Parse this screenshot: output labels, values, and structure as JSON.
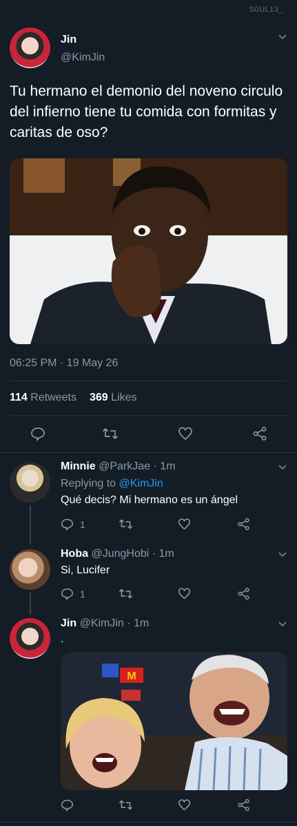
{
  "watermark": "S0UL13_",
  "main_tweet": {
    "name": "Jin",
    "handle": "@KimJin",
    "text": "Tu hermano el demonio del noveno circulo del infierno tiene tu comida con formitas y caritas de oso?",
    "timestamp": "06:25 PM · 19 May 26",
    "retweets_count": "114",
    "retweets_label": "Retweets",
    "likes_count": "369",
    "likes_label": "Likes"
  },
  "replies": [
    {
      "name": "Minnie",
      "handle": "@ParkJae",
      "time": "· 1m",
      "replying_prefix": "Replying to",
      "replying_to": "@KimJin",
      "text": "Qué decis? Mi hermano es un ángel",
      "reply_count": "1"
    },
    {
      "name": "Hoba",
      "handle": "@JungHobi",
      "time": "· 1m",
      "text": "Si, Lucifer",
      "reply_count": "1"
    },
    {
      "name": "Jin",
      "handle": "@KimJin",
      "time": "· 1m",
      "text": "."
    }
  ],
  "photo2_signs": {
    "sign_left": "🍟",
    "sign_m": "M"
  },
  "icons": [
    "reply-icon",
    "retweet-icon",
    "like-icon",
    "share-icon",
    "chevron-down-icon"
  ],
  "colors": {
    "background": "#141d26",
    "accent": "#1da1f2",
    "muted": "#8899a6",
    "divider": "#253341"
  }
}
